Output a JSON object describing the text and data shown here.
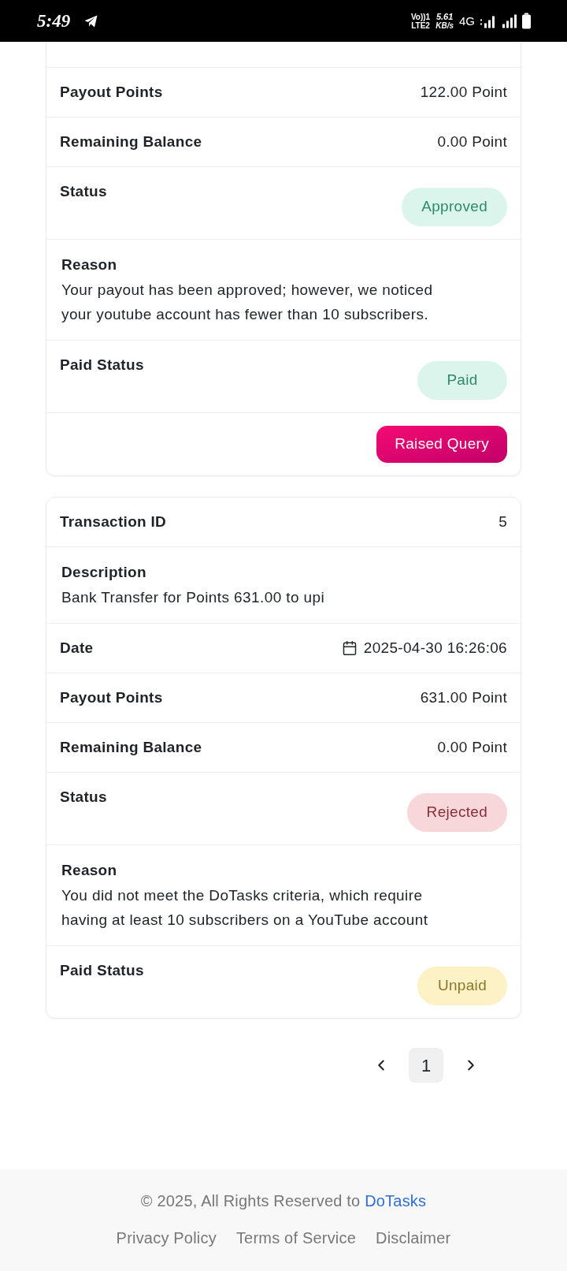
{
  "status_bar": {
    "time": "5:49",
    "volte": "Vo))1",
    "volte_sub": "LTE2",
    "speed": "5.61",
    "speed_unit": "KB/s",
    "network": "4G"
  },
  "transactions": [
    {
      "rows": [
        {
          "kind": "pair",
          "label": "Payout Points",
          "value": "122.00 Point"
        },
        {
          "kind": "pair",
          "label": "Remaining Balance",
          "value": "0.00 Point"
        },
        {
          "kind": "badge",
          "label": "Status",
          "badge": "Approved",
          "color": "#dcf5ec"
        },
        {
          "kind": "text",
          "label": "Reason",
          "text": "Your payout has been approved; however, we noticed your youtube account has fewer than 10 subscribers."
        },
        {
          "kind": "badge",
          "label": "Paid Status",
          "badge": "Paid",
          "color": "#dcf5ec"
        }
      ],
      "action": "Raised Query"
    },
    {
      "rows": [
        {
          "kind": "pair",
          "label": "Transaction ID",
          "value": "5"
        },
        {
          "kind": "text",
          "label": "Description",
          "text": "Bank Transfer for Points 631.00 to upi"
        },
        {
          "kind": "date",
          "label": "Date",
          "value": "2025-04-30 16:26:06"
        },
        {
          "kind": "pair",
          "label": "Payout Points",
          "value": "631.00 Point"
        },
        {
          "kind": "pair",
          "label": "Remaining Balance",
          "value": "0.00 Point"
        },
        {
          "kind": "badge",
          "label": "Status",
          "badge": "Rejected",
          "color": "#f7d7da"
        },
        {
          "kind": "text",
          "label": "Reason",
          "text": "You did not meet the DoTasks criteria, which require having at least 10 subscribers on a YouTube account"
        },
        {
          "kind": "badge",
          "label": "Paid Status",
          "badge": "Unpaid",
          "color": "#fdf1c6"
        }
      ]
    }
  ],
  "pagination": {
    "pages": [
      {
        "label": "1",
        "selected": true
      }
    ]
  },
  "footer": {
    "copyright": "© 2025, All Rights Reserved to",
    "brand_link": "DoTasks",
    "links": [
      "Privacy Policy",
      "Terms of Service",
      "Disclaimer"
    ]
  }
}
